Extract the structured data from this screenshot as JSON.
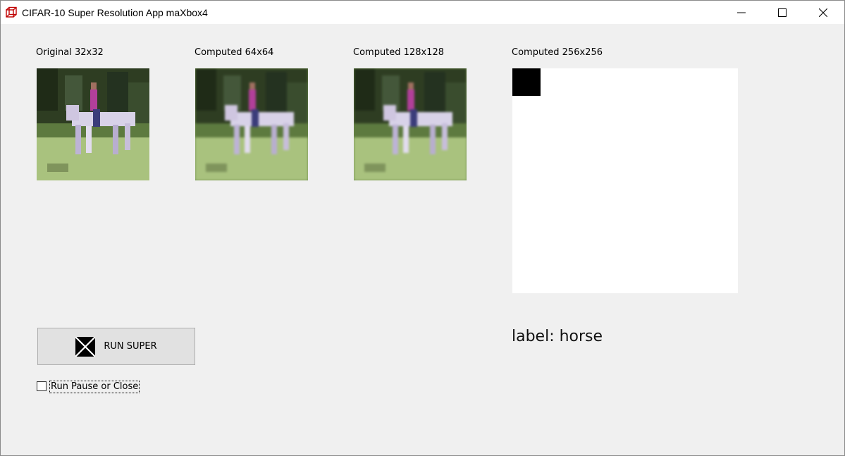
{
  "window": {
    "title": "CIFAR-10 Super Resolution App maXbox4"
  },
  "panels": [
    {
      "label": "Original 32x32"
    },
    {
      "label": "Computed 64x64"
    },
    {
      "label": "Computed 128x128"
    },
    {
      "label": "Computed 256x256"
    }
  ],
  "result": {
    "label_text": "label: horse"
  },
  "controls": {
    "run_button_label": "RUN SUPER",
    "checkbox_label": "Run Pause or Close",
    "checkbox_checked": false
  },
  "icons": {
    "app": "cube-icon",
    "run_button": "hourglass-x-icon",
    "minimize": "minimize-icon",
    "maximize": "maximize-icon",
    "close": "close-icon"
  }
}
